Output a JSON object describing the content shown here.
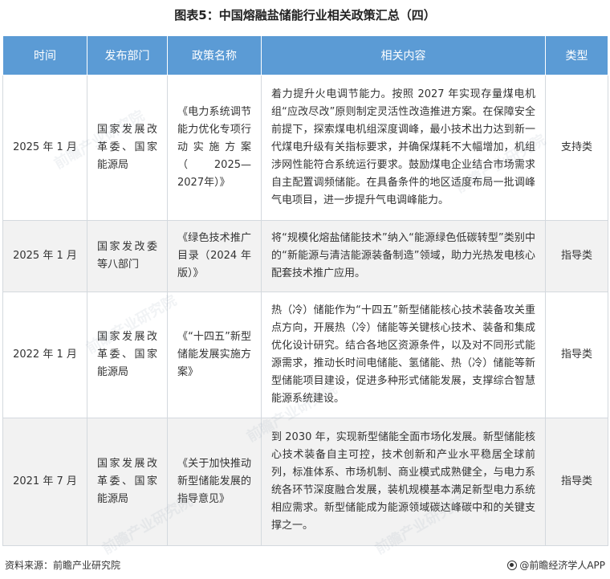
{
  "title": "图表5：中国熔融盐储能行业相关政策汇总（四）",
  "table": {
    "headers": [
      "时间",
      "发布部门",
      "政策名称",
      "相关内容",
      "类型"
    ],
    "rows": [
      {
        "time": "2025 年 1 月",
        "dept": "国家发展改革委、国家能源局",
        "name": "《电力系统调节能力优化专项行动实施方案（2025—2027年）》",
        "content": "着力提升火电调节能力。按照 2027 年实现存量煤电机组“应改尽改”原则制定灵活性改造推进方案。在保障安全前提下，探索煤电机组深度调峰，最小技术出力达到新一代煤电升级有关指标要求，并确保煤耗不大幅增加，机组涉网性能符合系统运行要求。鼓励煤电企业结合市场需求自主配置调频储能。在具备条件的地区适度布局一批调峰气电项目，进一步提升气电调峰能力。",
        "type": "支持类"
      },
      {
        "time": "2025 年 1 月",
        "dept": "国家发改委等八部门",
        "name": "《绿色技术推广目录（2024 年版）》",
        "content": "将“规模化熔盐储能技术”纳入“能源绿色低碳转型”类别中的“新能源与清洁能源装备制造”领域，助力光热发电核心配套技术推广应用。",
        "type": "指导类"
      },
      {
        "time": "2022 年 1 月",
        "dept": "国家发展改革委、国家能源局",
        "name": "《“十四五”新型储能发展实施方案》",
        "content": "热（冷）储能作为“十四五”新型储能核心技术装备攻关重点方向，开展热（冷）储能等关键核心技术、装备和集成优化设计研究。结合各地区资源条件，以及对不同形式能源需求，推动长时间电储能、氢储能、热（冷）储能等新型储能项目建设，促进多种形式储能发展，支撑综合智慧能源系统建设。",
        "type": "指导类"
      },
      {
        "time": "2021 年 7 月",
        "dept": "国家发展改革委、国家能源局",
        "name": "《关于加快推动新型储能发展的指导意见》",
        "content": "到 2030 年，实现新型储能全面市场化发展。新型储能核心技术装备自主可控，技术创新和产业水平稳居全球前列，标准体系、市场机制、商业模式成熟健全，与电力系统各环节深度融合发展，装机规模基本满足新型电力系统相应需求。新型储能成为能源领域碳达峰碳中和的关键支撑之一。",
        "type": "指导类"
      }
    ]
  },
  "footer": {
    "source": "资料来源：前瞻产业研究院",
    "brand": "@前瞻经济学人APP",
    "brand_icon": "qianzhan-logo-icon"
  },
  "watermark": "前瞻产业研究院"
}
